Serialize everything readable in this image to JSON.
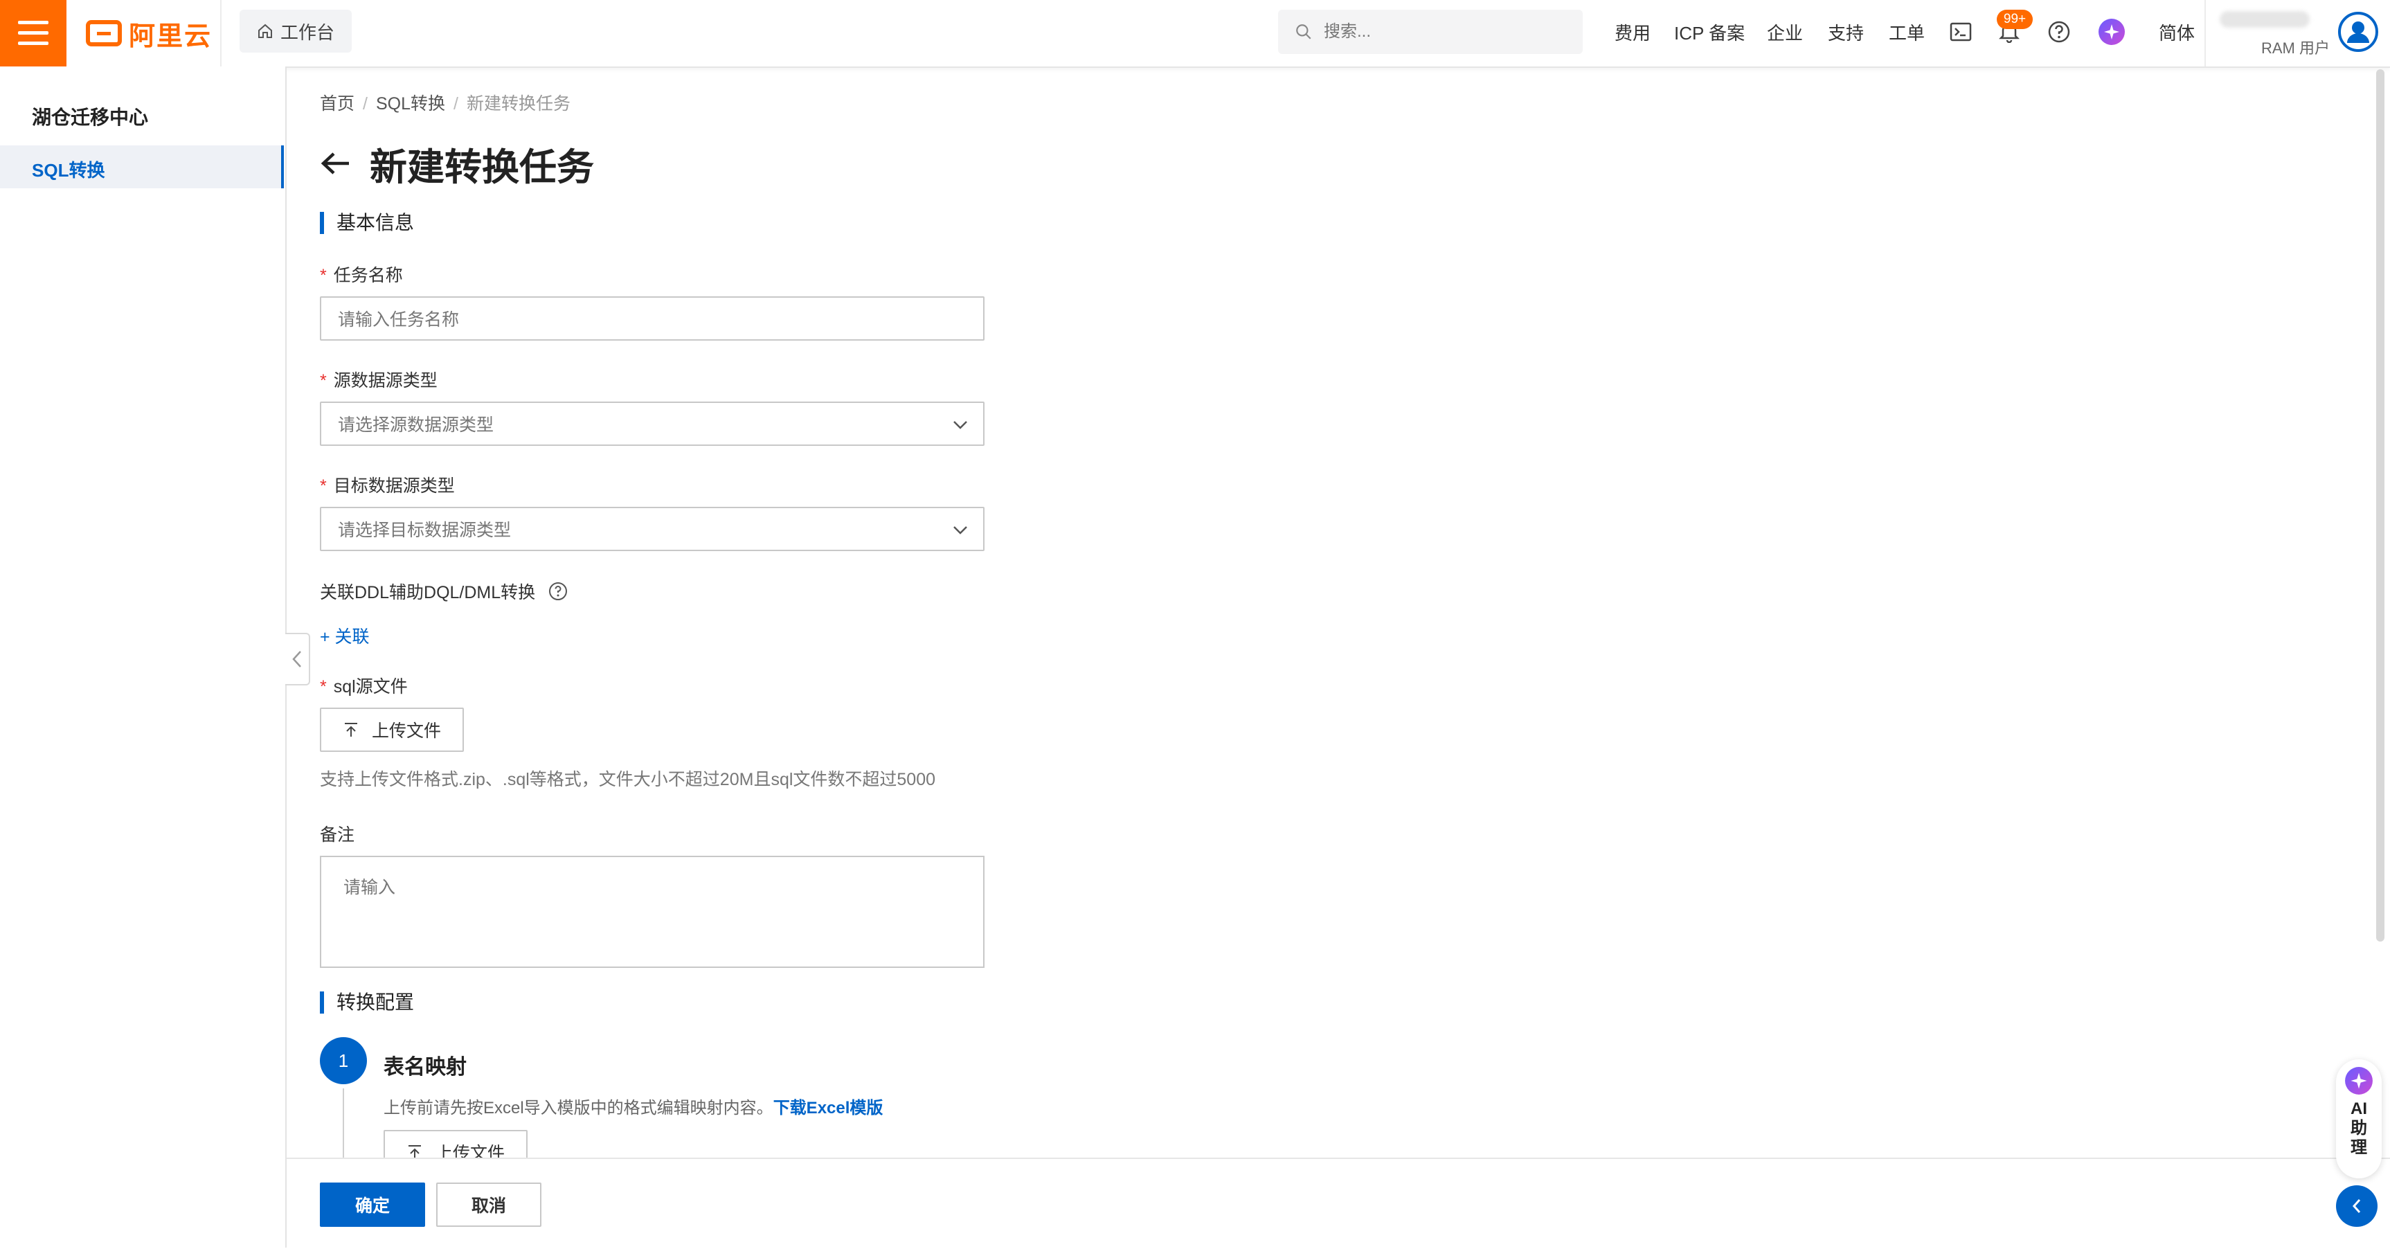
{
  "brand": {
    "logo_text": "阿里云",
    "accent": "#ff6a00",
    "primary": "#0064c8"
  },
  "topbar": {
    "workbench": "工作台",
    "search_placeholder": "搜索...",
    "links": {
      "fees": "费用",
      "icp": "ICP 备案",
      "enterprise": "企业",
      "support": "支持",
      "ticket": "工单",
      "language": "简体"
    },
    "notification_badge": "99+",
    "user_role": "RAM 用户"
  },
  "sidebar": {
    "title": "湖仓迁移中心",
    "items": [
      {
        "label": "SQL转换",
        "active": true
      }
    ]
  },
  "breadcrumb": {
    "home": "首页",
    "section": "SQL转换",
    "current": "新建转换任务"
  },
  "page": {
    "title": "新建转换任务"
  },
  "basic_info": {
    "section_title": "基本信息",
    "task_name": {
      "label": "任务名称",
      "placeholder": "请输入任务名称"
    },
    "source_type": {
      "label": "源数据源类型",
      "placeholder": "请选择源数据源类型"
    },
    "target_type": {
      "label": "目标数据源类型",
      "placeholder": "请选择目标数据源类型"
    },
    "ddl_assist": {
      "label": "关联DDL辅助DQL/DML转换",
      "link": "+ 关联"
    },
    "sql_file": {
      "label": "sql源文件",
      "upload": "上传文件",
      "hint": "支持上传文件格式.zip、.sql等格式，文件大小不超过20M且sql文件数不超过5000"
    },
    "remark": {
      "label": "备注",
      "placeholder": "请输入"
    }
  },
  "convert_config": {
    "section_title": "转换配置",
    "steps": [
      {
        "number": "1",
        "title": "表名映射",
        "desc": "上传前请先按Excel导入模版中的格式编辑映射内容。",
        "link": "下载Excel模版",
        "upload": "上传文件"
      }
    ]
  },
  "footer": {
    "confirm": "确定",
    "cancel": "取消"
  },
  "assistant": {
    "label": "AI助理"
  }
}
